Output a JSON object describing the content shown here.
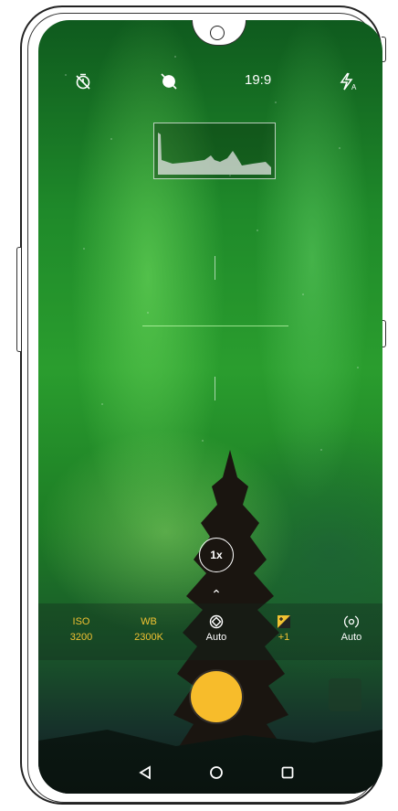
{
  "top_bar": {
    "timer_icon": "timer-off-icon",
    "filter_icon": "filter-off-icon",
    "aspect_ratio": "19:9",
    "flash_icon": "flash-auto-icon"
  },
  "zoom": {
    "label": "1x"
  },
  "pro_controls": [
    {
      "label": "ISO",
      "value": "3200",
      "color": "#f1c232"
    },
    {
      "label": "WB",
      "value": "2300K",
      "color": "#f1c232"
    },
    {
      "label": "focus-auto-icon",
      "value": "Auto",
      "color": "#ffffff"
    },
    {
      "label": "exposure-icon",
      "value": "+1",
      "color": "#f1c232"
    },
    {
      "label": "metering-icon",
      "value": "Auto",
      "color": "#ffffff"
    }
  ],
  "shutter": {
    "color": "#f7bc2b"
  },
  "nav": {
    "back_icon": "back-triangle-icon",
    "home_icon": "home-circle-icon",
    "recents_icon": "recents-square-icon"
  }
}
